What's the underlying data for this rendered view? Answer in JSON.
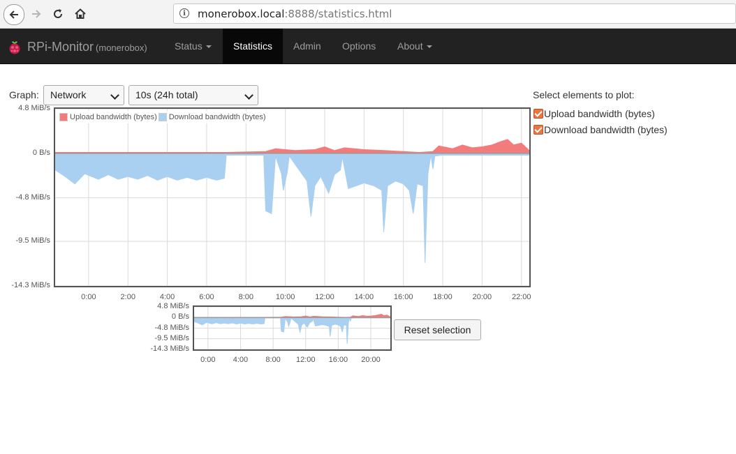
{
  "browser": {
    "url_host": "monerobox.local",
    "url_rest": ":8888/statistics.html"
  },
  "navbar": {
    "brand": "RPi-Monitor",
    "hostname": "(monerobox)",
    "items": [
      {
        "label": "Status",
        "dropdown": true,
        "active": false
      },
      {
        "label": "Statistics",
        "dropdown": false,
        "active": true
      },
      {
        "label": "Admin",
        "dropdown": false,
        "active": false
      },
      {
        "label": "Options",
        "dropdown": false,
        "active": false
      },
      {
        "label": "About",
        "dropdown": true,
        "active": false
      }
    ]
  },
  "controls": {
    "graph_label": "Graph:",
    "graph_select": "Network",
    "interval_select": "10s (24h total)",
    "reset_button": "Reset selection"
  },
  "plot_panel": {
    "title": "Select elements to plot:",
    "elements": [
      {
        "label": "Upload bandwidth (bytes)",
        "checked": true
      },
      {
        "label": "Download bandwidth (bytes)",
        "checked": true
      }
    ]
  },
  "colors": {
    "upload": "#f47b7b",
    "download": "#a9d0f0",
    "grid": "#d9d9d9",
    "accent": "#e9773f"
  },
  "chart_data": [
    {
      "type": "area",
      "ylabel_unit": "MiB/s",
      "y_ticks": [
        "4.8 MiB/s",
        "0 B/s",
        "-4.8 MiB/s",
        "-9.5 MiB/s",
        "-14.3 MiB/s"
      ],
      "x_ticks": [
        "0:00",
        "2:00",
        "4:00",
        "6:00",
        "8:00",
        "10:00",
        "12:00",
        "14:00",
        "16:00",
        "18:00",
        "20:00",
        "22:00"
      ],
      "ylim": [
        -14.3,
        4.8
      ],
      "xlim": [
        -1.7,
        22.4
      ],
      "legend": "top-left",
      "grid": true,
      "series": [
        {
          "name": "Upload bandwidth (bytes)",
          "points": [
            [
              -1.7,
              0.1
            ],
            [
              0,
              0.1
            ],
            [
              2,
              0.1
            ],
            [
              4,
              0.1
            ],
            [
              6,
              0.1
            ],
            [
              7.0,
              0.1
            ],
            [
              9.0,
              0.2
            ],
            [
              9.5,
              0.5
            ],
            [
              10.5,
              0.3
            ],
            [
              11.5,
              0.4
            ],
            [
              12.0,
              0.7
            ],
            [
              12.5,
              0.3
            ],
            [
              13.0,
              0.6
            ],
            [
              14.0,
              0.4
            ],
            [
              15.0,
              0.3
            ],
            [
              16.0,
              0.2
            ],
            [
              16.8,
              0.1
            ],
            [
              17.5,
              0.2
            ],
            [
              17.8,
              0.8
            ],
            [
              18.5,
              0.5
            ],
            [
              19.0,
              0.9
            ],
            [
              19.5,
              0.6
            ],
            [
              20.0,
              0.7
            ],
            [
              20.5,
              0.9
            ],
            [
              21.0,
              1.3
            ],
            [
              21.3,
              1.5
            ],
            [
              21.6,
              0.9
            ],
            [
              22.0,
              1.1
            ],
            [
              22.4,
              0.3
            ]
          ]
        },
        {
          "name": "Download bandwidth (bytes)",
          "points": [
            [
              -1.7,
              -1.8
            ],
            [
              -1.2,
              -2.5
            ],
            [
              -0.7,
              -3.3
            ],
            [
              -0.2,
              -2.2
            ],
            [
              0.5,
              -2.8
            ],
            [
              1.0,
              -2.3
            ],
            [
              1.5,
              -2.8
            ],
            [
              2.0,
              -2.5
            ],
            [
              2.5,
              -2.8
            ],
            [
              3.0,
              -2.4
            ],
            [
              3.5,
              -2.9
            ],
            [
              4.0,
              -2.5
            ],
            [
              4.5,
              -2.9
            ],
            [
              5.0,
              -2.6
            ],
            [
              5.5,
              -2.9
            ],
            [
              6.0,
              -2.6
            ],
            [
              6.5,
              -2.9
            ],
            [
              6.9,
              -2.7
            ],
            [
              7.0,
              -0.2
            ],
            [
              8.9,
              -0.2
            ],
            [
              9.0,
              -6.2
            ],
            [
              9.3,
              -6.5
            ],
            [
              9.5,
              -0.3
            ],
            [
              9.8,
              -2.2
            ],
            [
              9.9,
              -4.0
            ],
            [
              10.1,
              -2.0
            ],
            [
              10.2,
              -0.3
            ],
            [
              10.7,
              -1.8
            ],
            [
              11.1,
              -3.0
            ],
            [
              11.3,
              -6.8
            ],
            [
              11.5,
              -3.5
            ],
            [
              11.8,
              -2.5
            ],
            [
              12.2,
              -4.3
            ],
            [
              12.5,
              -2.3
            ],
            [
              12.8,
              -1.8
            ],
            [
              12.9,
              -0.4
            ],
            [
              13.2,
              -3.8
            ],
            [
              13.6,
              -3.5
            ],
            [
              14.0,
              -3.2
            ],
            [
              14.5,
              -3.5
            ],
            [
              14.9,
              -4.0
            ],
            [
              15.0,
              -8.5
            ],
            [
              15.2,
              -3.5
            ],
            [
              15.6,
              -3.0
            ],
            [
              16.0,
              -3.3
            ],
            [
              16.3,
              -4.0
            ],
            [
              16.5,
              -6.5
            ],
            [
              16.7,
              -3.3
            ],
            [
              17.0,
              -3.5
            ],
            [
              17.1,
              -11.8
            ],
            [
              17.25,
              -2.2
            ],
            [
              17.4,
              -0.2
            ],
            [
              17.5,
              -1.7
            ],
            [
              17.6,
              -0.3
            ],
            [
              18.0,
              -0.2
            ],
            [
              20,
              -0.2
            ],
            [
              22.4,
              -0.2
            ]
          ]
        }
      ]
    },
    {
      "type": "area",
      "role": "overview",
      "y_ticks": [
        "4.8 MiB/s",
        "0 B/s",
        "-4.8 MiB/s",
        "-9.5 MiB/s",
        "-14.3 MiB/s"
      ],
      "x_ticks": [
        "0:00",
        "4:00",
        "8:00",
        "12:00",
        "16:00",
        "20:00"
      ],
      "ylim": [
        -14.3,
        4.8
      ],
      "xlim": [
        -1.7,
        22.4
      ],
      "grid": true
    }
  ]
}
